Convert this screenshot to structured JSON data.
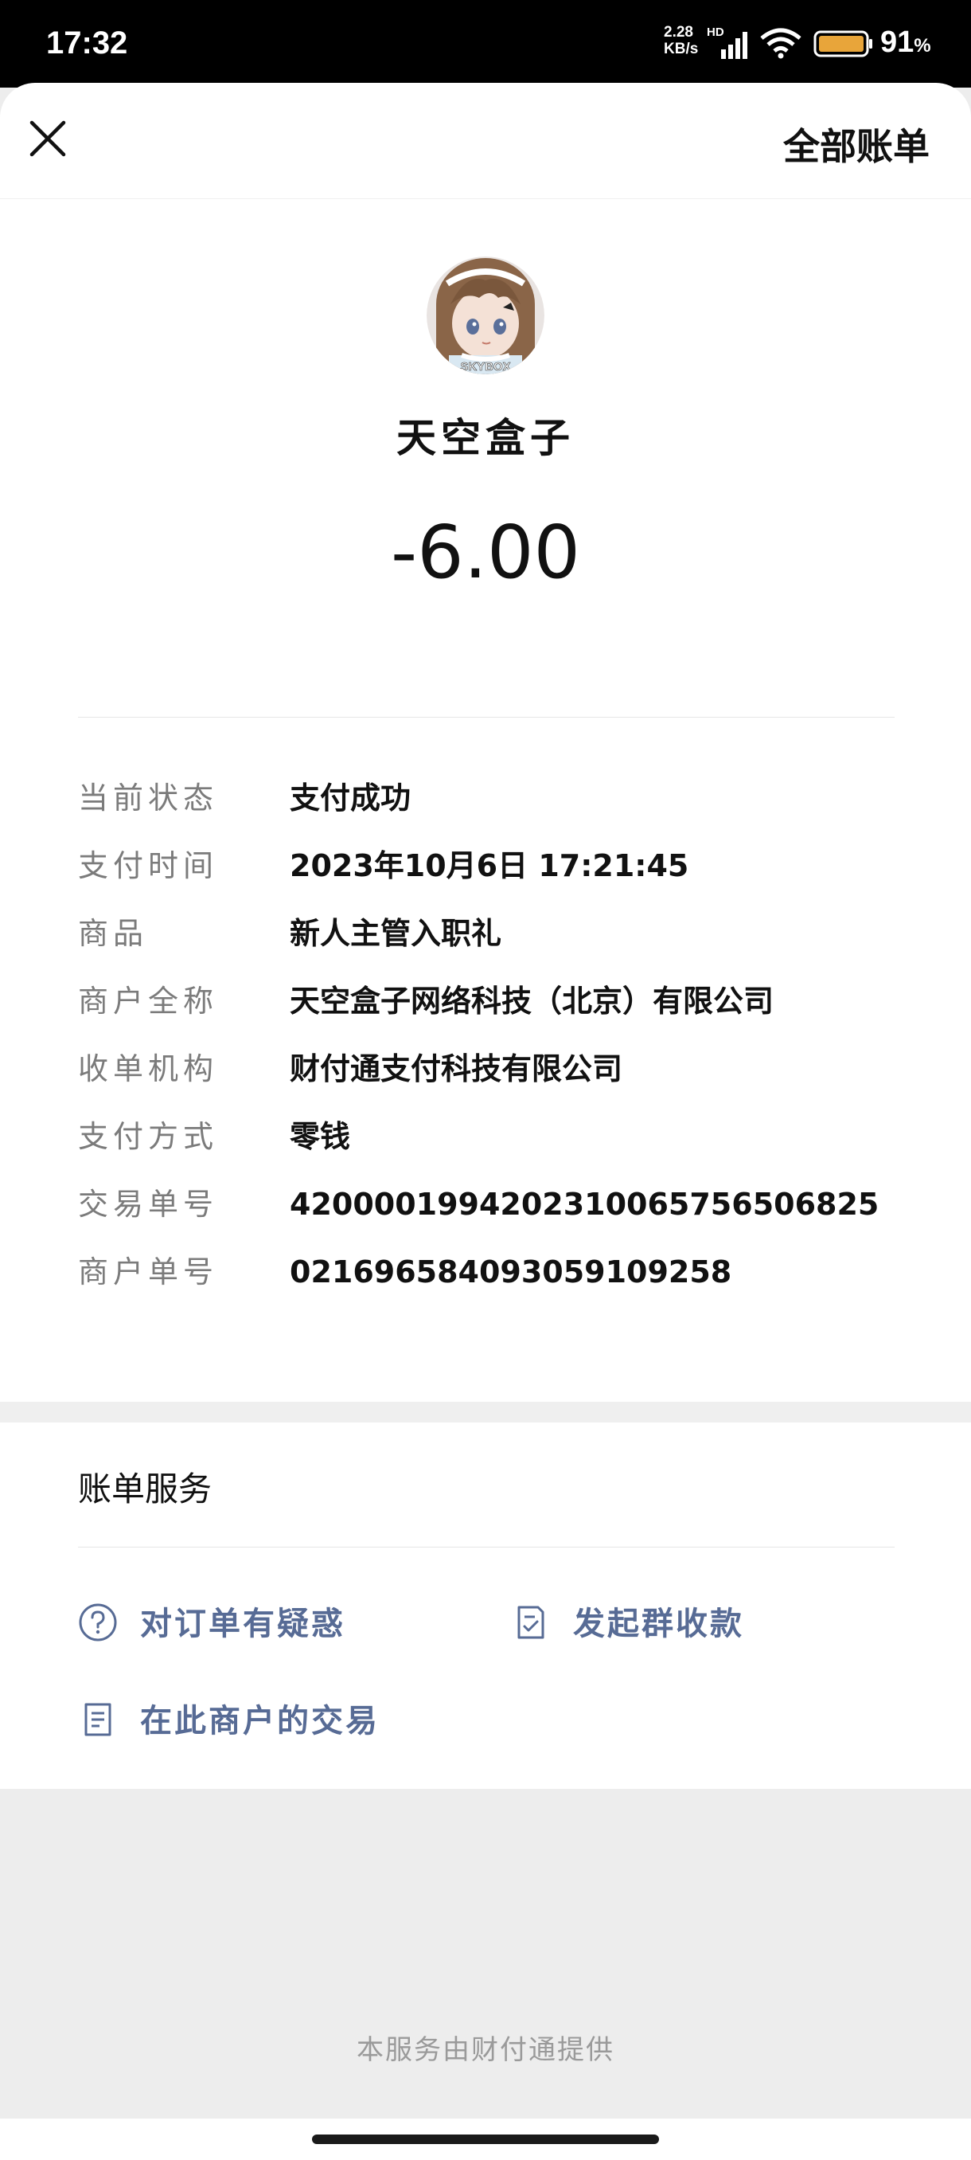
{
  "status_bar": {
    "time": "17:32",
    "net_speed_value": "2.28",
    "net_speed_unit": "KB/s",
    "net_type": "HD",
    "battery_number": "91",
    "battery_percent_sign": "%",
    "icons": [
      "signal-icon",
      "wifi-icon",
      "battery-icon"
    ]
  },
  "nav": {
    "close_icon": "close-icon",
    "all_bills_label": "全部账单"
  },
  "merchant": {
    "avatar_icon": "avatar",
    "avatar_text": "SKYBOX",
    "name": "天空盒子",
    "amount": "-6.00"
  },
  "details": [
    {
      "label": "当前状态",
      "value": "支付成功"
    },
    {
      "label": "支付时间",
      "value": "2023年10月6日 17:21:45"
    },
    {
      "label": "商品",
      "value": "新人主管入职礼"
    },
    {
      "label": "商户全称",
      "value": "天空盒子网络科技（北京）有限公司"
    },
    {
      "label": "收单机构",
      "value": "财付通支付科技有限公司"
    },
    {
      "label": "支付方式",
      "value": "零钱"
    },
    {
      "label": "交易单号",
      "value": "4200001994202310065756506825"
    },
    {
      "label": "商户单号",
      "value": "021696584093059109258"
    }
  ],
  "services": {
    "title": "账单服务",
    "links": [
      {
        "icon": "question-circle-icon",
        "label": "对订单有疑惑"
      },
      {
        "icon": "checklist-icon",
        "label": "发起群收款"
      },
      {
        "icon": "document-icon",
        "label": "在此商户的交易"
      }
    ]
  },
  "footer": {
    "note": "本服务由财付通提供"
  },
  "colors": {
    "link_blue": "#576b95",
    "label_gray": "#7b7b7b",
    "page_gray": "#ededed"
  }
}
